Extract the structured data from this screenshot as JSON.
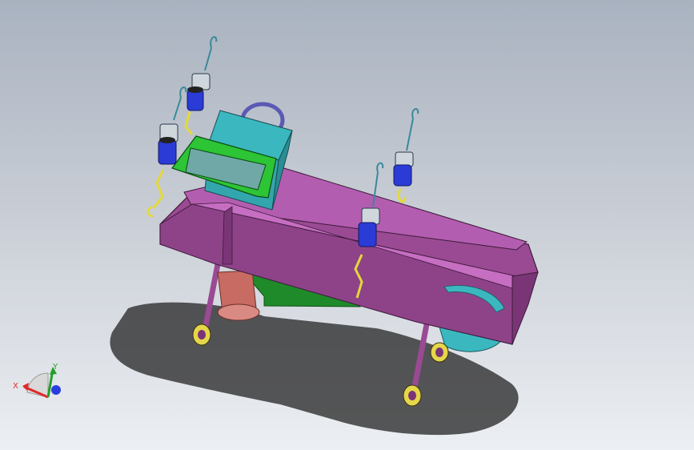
{
  "view": {
    "background_top": "#a9b2c0",
    "background_bottom": "#eceff3"
  },
  "model": {
    "colors": {
      "trough": "#9a4a93",
      "trough_light": "#b35db0",
      "trough_dark": "#7a3577",
      "hopper": "#3bb8bf",
      "hopper_frame": "#2dc435",
      "green_panel": "#1f8a2a",
      "outlet": "#c76b63",
      "spring": "#2b3bd6",
      "chain": "#e3d93a",
      "hook": "#3a8a9a",
      "handwheel": "#5a5ab5",
      "wheel": "#e5d64a",
      "shadow": "#2a2a2a"
    },
    "icons": [
      "axis-triad-icon"
    ]
  },
  "triad": {
    "x_label": "X",
    "y_label": "Y",
    "x_color": "#e02a2a",
    "y_color": "#1fa02a",
    "z_color": "#2a3ee0"
  }
}
